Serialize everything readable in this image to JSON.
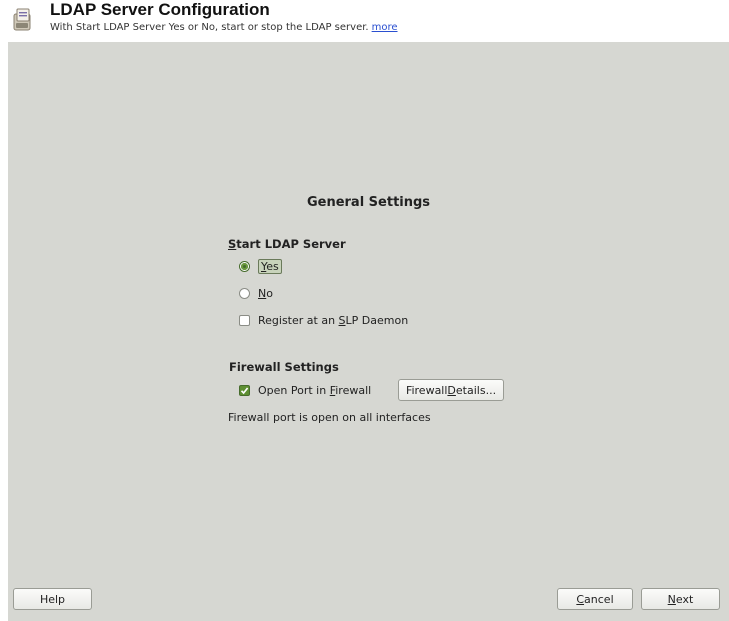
{
  "header": {
    "title": "LDAP Server Configuration",
    "subtitle": "With Start LDAP Server Yes or No, start or stop the LDAP server.",
    "more_link": "more",
    "icon": "ldap-config-icon"
  },
  "main": {
    "section_title": "General Settings",
    "start_server": {
      "label_prefix": "S",
      "label_rest": "tart LDAP Server",
      "yes": {
        "mnemonic": "Y",
        "rest": "es",
        "checked": true
      },
      "no": {
        "mnemonic": "N",
        "rest": "o",
        "checked": false
      },
      "register_slp": {
        "before": "Register at an ",
        "mnemonic": "S",
        "after": "LP Daemon",
        "checked": false
      }
    },
    "firewall": {
      "label": "Firewall Settings",
      "open_port": {
        "before": "Open Port in ",
        "mnemonic": "F",
        "after": "irewall",
        "checked": true
      },
      "details_button": {
        "before": "Firewall ",
        "mnemonic": "D",
        "after": "etails..."
      },
      "status": "Firewall port is open on all interfaces"
    }
  },
  "footer": {
    "help": "Help",
    "cancel": {
      "mnemonic": "C",
      "rest": "ancel"
    },
    "next": {
      "mnemonic": "N",
      "rest": "ext"
    }
  },
  "colors": {
    "panel_bg": "#d6d7d2",
    "accent_green": "#5e8f32",
    "link_blue": "#2a4fd0"
  }
}
